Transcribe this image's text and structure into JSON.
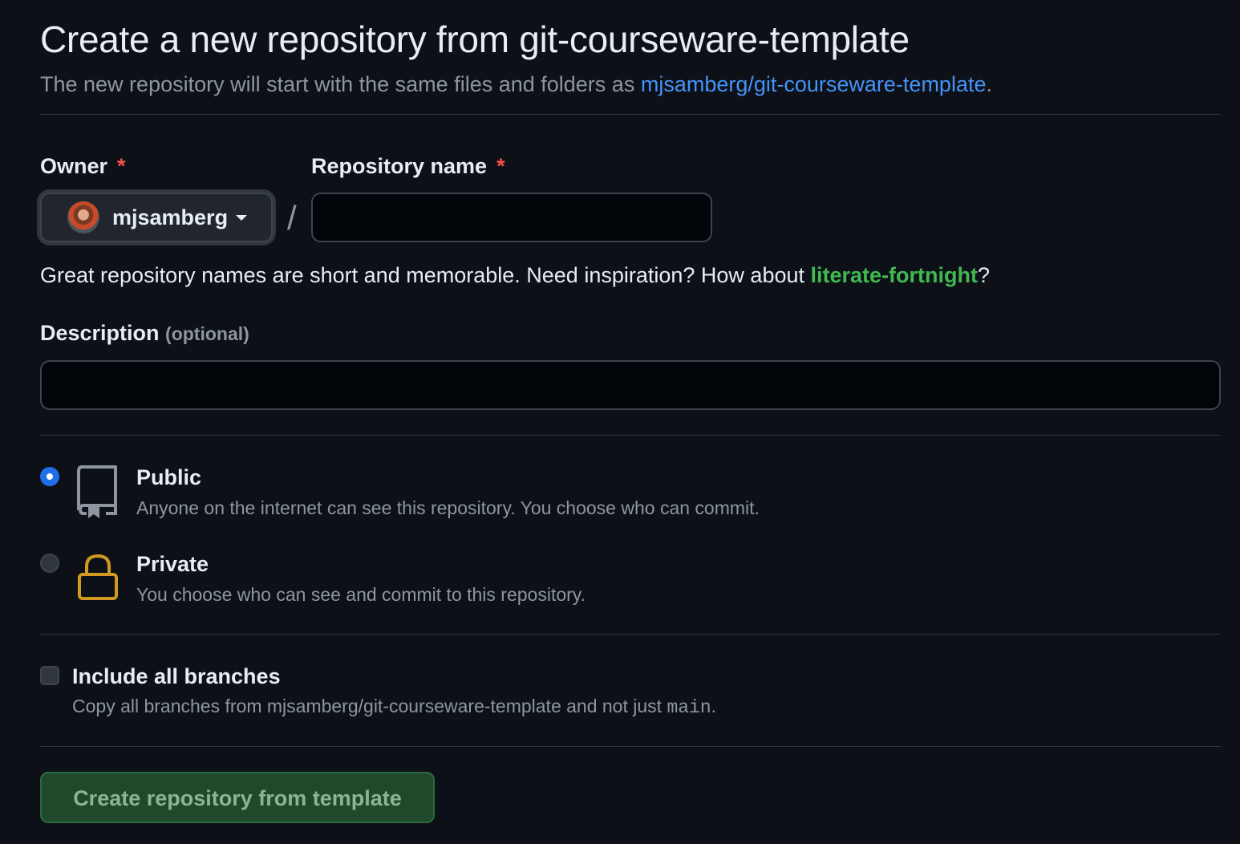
{
  "header": {
    "title": "Create a new repository from git-courseware-template",
    "subtitle_prefix": "The new repository will start with the same files and folders as ",
    "template_link": "mjsamberg/git-courseware-template",
    "subtitle_suffix": "."
  },
  "owner": {
    "label": "Owner",
    "required_mark": "*",
    "selected": "mjsamberg"
  },
  "repo_name": {
    "label": "Repository name",
    "required_mark": "*",
    "value": "",
    "separator": "/"
  },
  "name_hint": {
    "prefix": "Great repository names are short and memorable. Need inspiration? How about ",
    "suggestion": "literate-fortnight",
    "suffix": "?"
  },
  "description": {
    "label": "Description",
    "optional": "(optional)",
    "value": ""
  },
  "visibility": {
    "options": [
      {
        "title": "Public",
        "desc": "Anyone on the internet can see this repository. You choose who can commit.",
        "selected": true,
        "icon": "repo-icon"
      },
      {
        "title": "Private",
        "desc": "You choose who can see and commit to this repository.",
        "selected": false,
        "icon": "lock-icon"
      }
    ]
  },
  "branches": {
    "label": "Include all branches",
    "desc_prefix": "Copy all branches from mjsamberg/git-courseware-template and not just ",
    "desc_code": "main",
    "desc_suffix": ".",
    "checked": false
  },
  "submit": {
    "label": "Create repository from template"
  },
  "colors": {
    "background": "#0d1117",
    "link": "#4493f8",
    "suggestion": "#3fb950",
    "required": "#f85149",
    "lock": "#d29922",
    "submit_bg": "#1e4a2b"
  }
}
